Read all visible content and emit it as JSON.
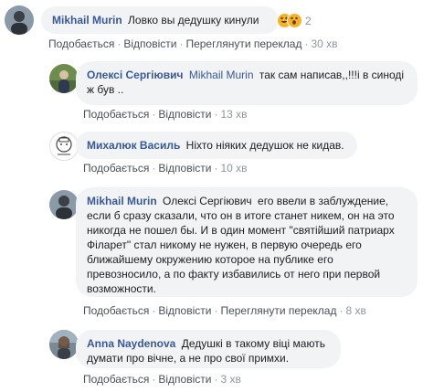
{
  "comments": [
    {
      "author": "Mikhail Murin",
      "text": "Ловко вы дедушку кинули",
      "reaction_count": "2",
      "actions": {
        "like": "Подобається",
        "reply": "Відповісти",
        "translate": "Переглянути переклад",
        "time": "30 хв"
      }
    },
    {
      "author": "Олексі Сергіювич",
      "mention": "Mikhail Murin",
      "text": "так сам написав,,!!!і в синоді ж був ..",
      "actions": {
        "like": "Подобається",
        "reply": "Відповісти",
        "time": "13 хв"
      }
    },
    {
      "author": "Михалюк Василь",
      "text": "Ніхто ніяких дедушок не кидав.",
      "actions": {
        "like": "Подобається",
        "reply": "Відповісти",
        "time": "10 хв"
      }
    },
    {
      "author": "Mikhail Murin",
      "mention": "Олексі Сергіювич",
      "text": "его ввели в заблуждение, если б сразу сказали, что он в итоге станет никем, он на это никогда не пошел бы. И в один момент \"святійший патриарх Філарет\" стал никому не нужен, в первую очередь его ближайшему окружению которое на публике его превозносило, а по факту избавились от него при первой возможности.",
      "actions": {
        "like": "Подобається",
        "reply": "Відповісти",
        "translate": "Переглянути переклад",
        "time": "8 хв"
      }
    },
    {
      "author": "Anna Naydenova",
      "text": "Дедушкі в такому віці мають думати про вічне, а не про свої примхи.",
      "actions": {
        "like": "Подобається",
        "reply": "Відповісти",
        "time": "3 хв"
      }
    }
  ],
  "colors": {
    "author": "#385898",
    "bubble": "#f2f3f5",
    "meta": "#90949c",
    "reaction": "#f7b125"
  }
}
